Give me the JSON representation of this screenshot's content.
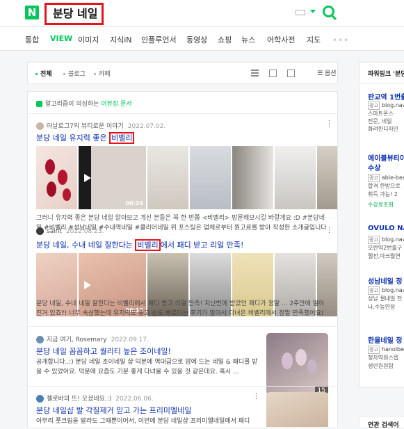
{
  "header": {
    "logo": "N",
    "query": "분당 네일"
  },
  "tabs": [
    {
      "label": "통합"
    },
    {
      "label": "VIEW"
    },
    {
      "label": "이미지"
    },
    {
      "label": "지식iN"
    },
    {
      "label": "인플루언서"
    },
    {
      "label": "동영상"
    },
    {
      "label": "쇼핑"
    },
    {
      "label": "뉴스"
    },
    {
      "label": "어학사전"
    },
    {
      "label": "지도"
    }
  ],
  "tabs_more": "•••",
  "filter": {
    "all": "전체",
    "blog": "블로그",
    "cafe": "카페",
    "options": "옵션"
  },
  "algo_notice": {
    "prefix": "알고리즘이 의심하는 ",
    "link": "어뷰징 문서"
  },
  "posts": [
    {
      "author": "아날로그7의 뷰티로운 이야기",
      "date": "2022.07.02.",
      "title_pre": "분당 네일 유지력 좋은 ",
      "title_mark": "비벨리",
      "title_post": "",
      "duration": "00:24",
      "snippet": "그러니 유지력 좋은 분당 네일 알아보고 계신 분들은 꼭 한 번쯤 <비벨리> 방문해보시길 바랄게요 :D #분당네일 #비벨리 #성남네일 #수내역네일 #클리어네일 위 포스팅은 업체로부터 원고료를 받아 작성한 소개글입니다"
    },
    {
      "author": "saint",
      "date": "2022.08.23.",
      "title_pre": "분당 네일, 수내 네일 잘한다는 ",
      "title_mark": "비벨리",
      "title_post": "에서 패디 받고 리얼 만족!",
      "duration": "00:18",
      "snippet": "분당 네일, 수내 네일 잘한다는 비벨리에서 패디 받고 리얼 만족! 지난번에 받았던 패디가 정말 ... 2주만에 떨어진거 있죠?! 너무 속상했는데 유지력도 좋고 손도 빠르다는 후기가 많아서 다녀온 비벨리에서 정말 만족했어요!"
    },
    {
      "author": "지금 여기, Rosemary",
      "date": "2022.09.17.",
      "title": "분당 네일 꼼꼼하고 퀄리티 높은 조이네일!",
      "snippet": "공개합니다..:) 분당 네일 조이네일 샵 덕분에 역대급으로 맘에 드는 네일 & 패디를 받을 수 있었어요. 덕분에 요즘도 기분 좋게 다녀올 수 있을 것 같은데요. 혹시 ...",
      "count": "15"
    },
    {
      "author": "젤로바의 뜨! 오셨네요.:)",
      "date": "2022.06.06.",
      "title": "분당 네일샵 발 각질제거 믿고 가는 프리미엘네일",
      "snippet": "아무리 풋크림을 발라도 그때뿐이어서, 이번에 분당 네일샵 프리미엘네일에서 패디"
    }
  ],
  "sidebar": {
    "title": "파워링크 '분당",
    "ads": [
      {
        "title": "판교역 1번출",
        "url": "blog.nav",
        "desc1": "스마트폰스",
        "desc2": "전문, 네일",
        "desc3": "화려한디자인"
      },
      {
        "title": "에이블뷰티아",
        "title2": "수상",
        "url": "able-bea",
        "desc1": "합격 한방으로",
        "desc2": "취득 가능! 2",
        "link": "수강료조회"
      },
      {
        "title": "OVULO NAIL",
        "url": "blog.nav",
        "desc1": "모란역2번출구",
        "desc2": "젤전,아크릴연"
      },
      {
        "title": "성남네일 정",
        "url": "blog.nav",
        "desc1": "성남 젤네일 전",
        "desc2": "나,수능연장"
      },
      {
        "title": "한올네일 정",
        "url": "hanolbea",
        "desc1": "정자역원스텝",
        "desc2": "생만원원탐"
      }
    ],
    "related_title": "연관 검색어"
  },
  "colors": {
    "brand": "#03c75a",
    "link": "#0b2fb0",
    "highlight": "#e5141a"
  }
}
